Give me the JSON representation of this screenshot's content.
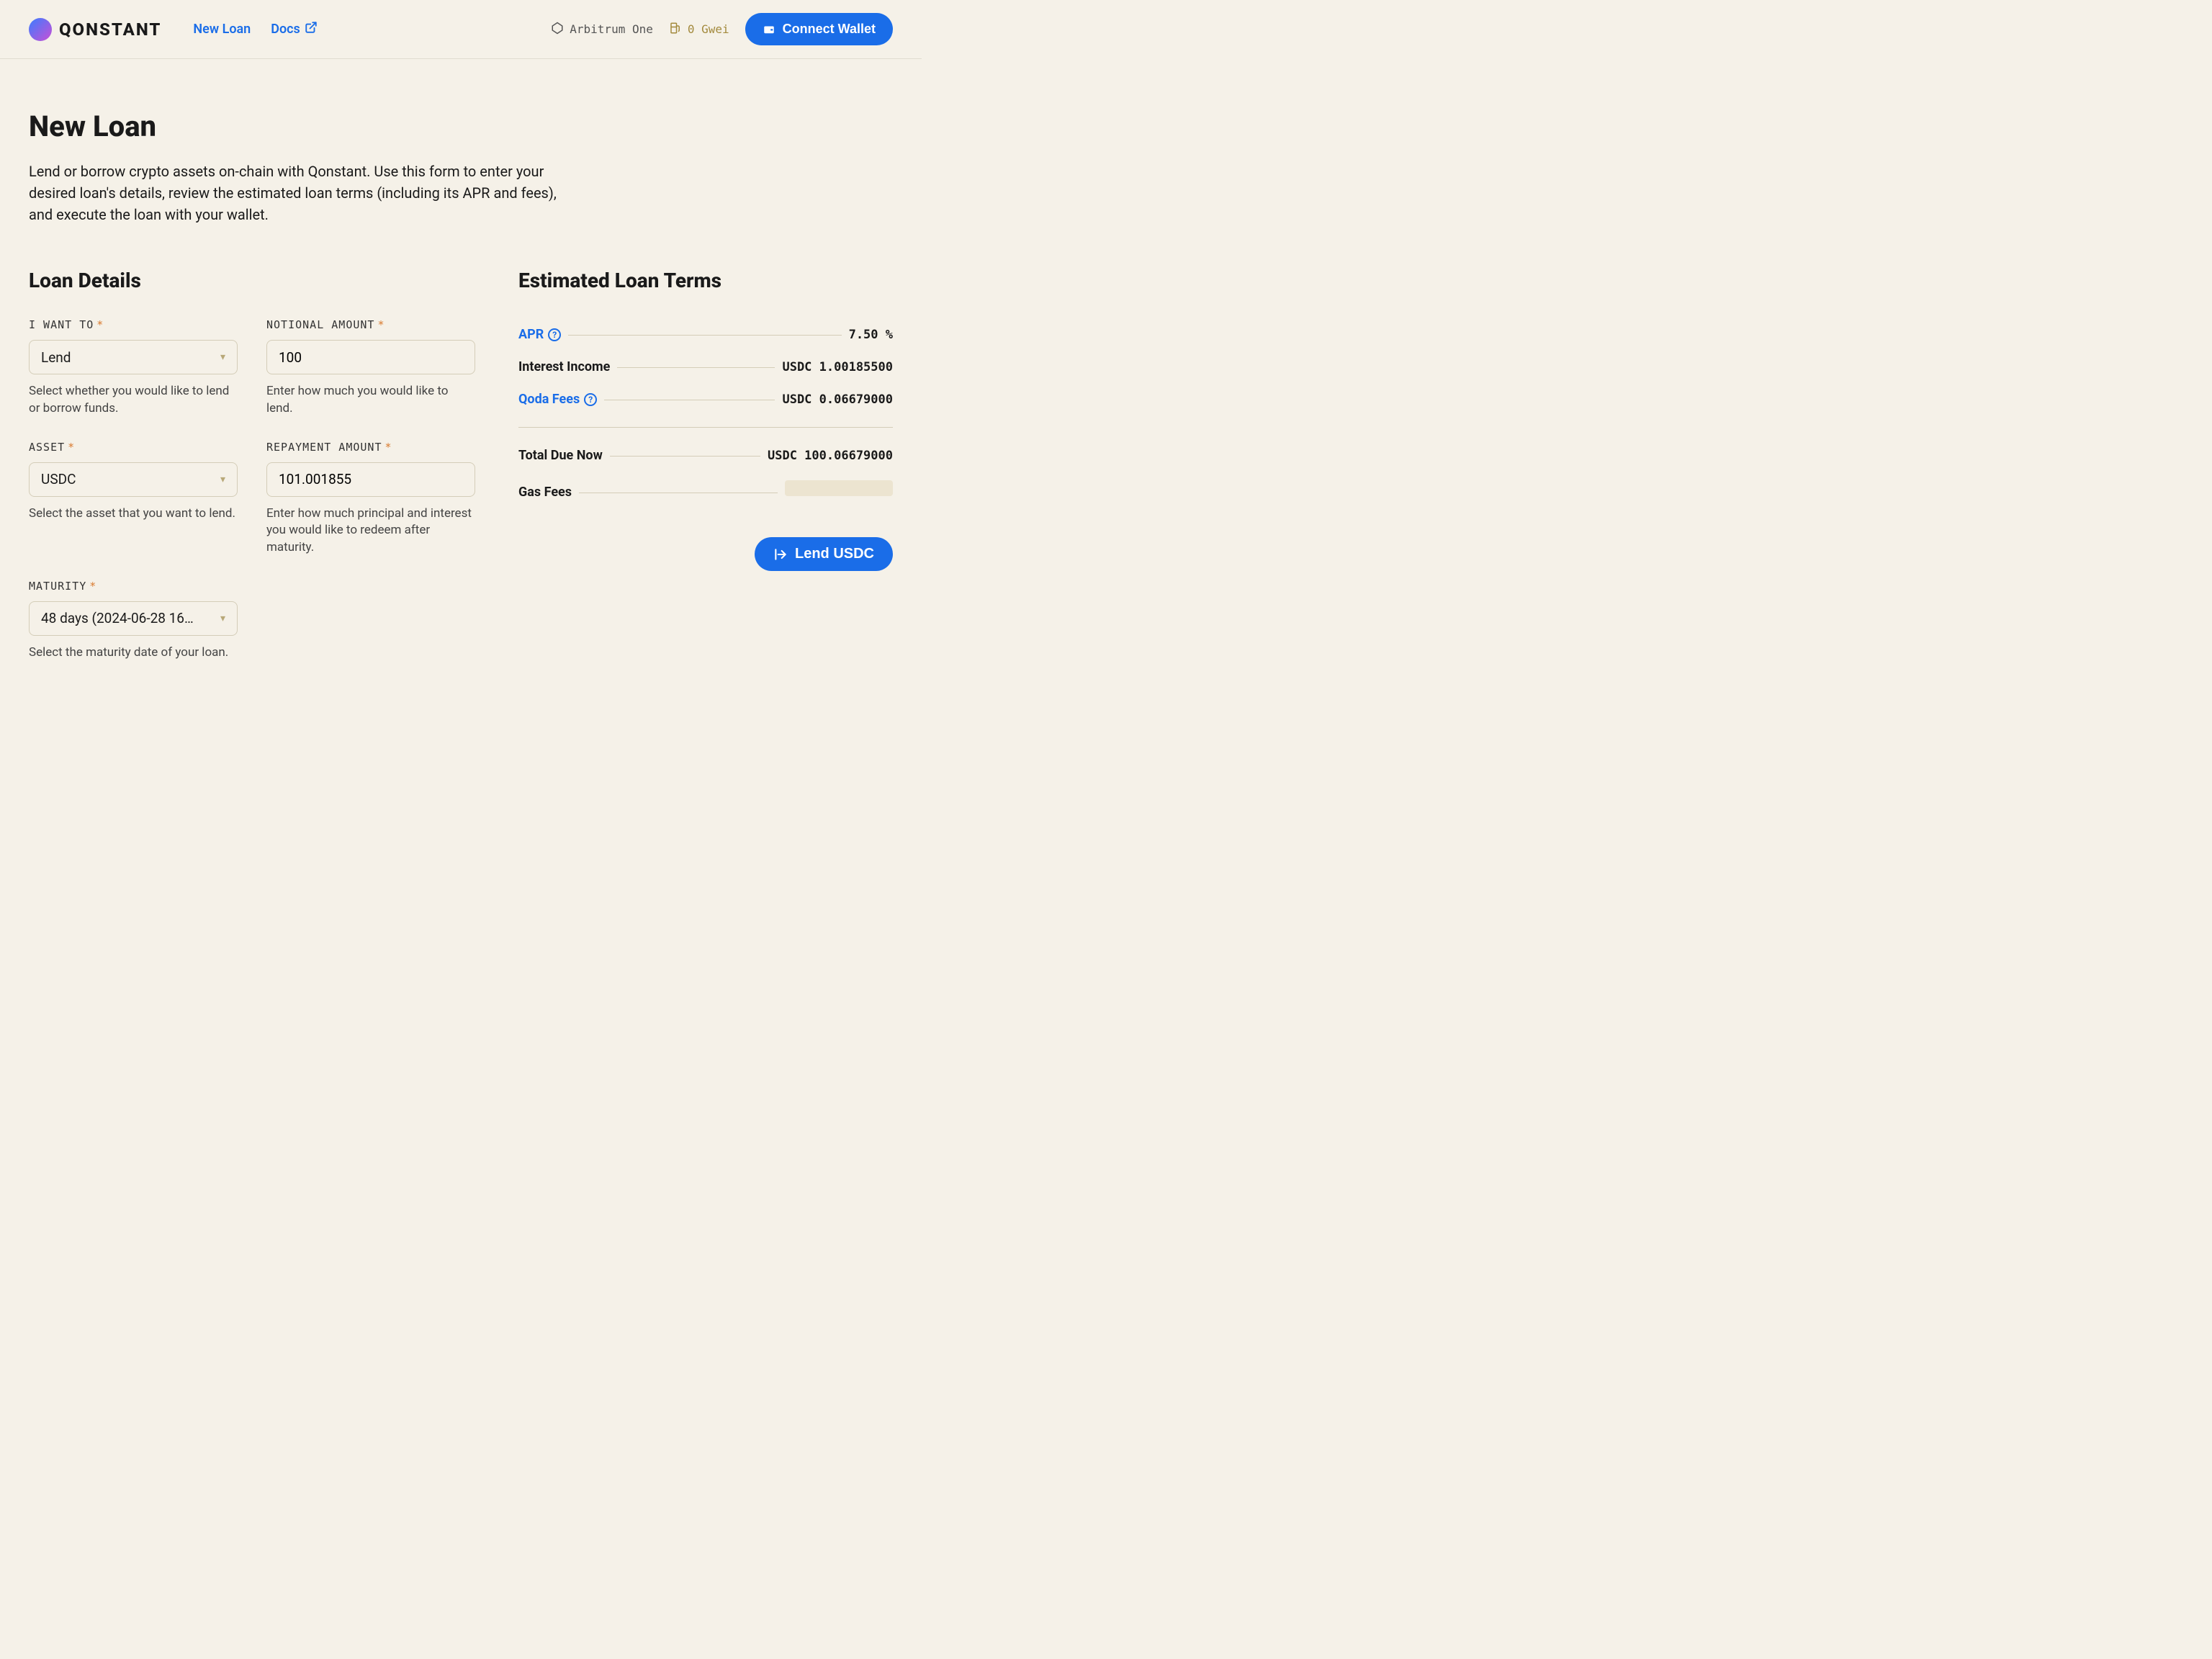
{
  "header": {
    "brand": "QONSTANT",
    "nav": {
      "new_loan": "New Loan",
      "docs": "Docs"
    },
    "chain": "Arbitrum One",
    "gas": "0 Gwei",
    "connect": "Connect Wallet"
  },
  "page": {
    "title": "New Loan",
    "description": "Lend or borrow crypto assets on-chain with Qonstant. Use this form to enter your desired loan's details, review the estimated loan terms (including its APR and fees), and execute the loan with your wallet."
  },
  "loan_details": {
    "title": "Loan Details",
    "i_want_to": {
      "label": "I WANT TO",
      "value": "Lend",
      "help": "Select whether you would like to lend or borrow funds."
    },
    "asset": {
      "label": "ASSET",
      "value": "USDC",
      "help": "Select the asset that you want to lend."
    },
    "maturity": {
      "label": "MATURITY",
      "value": "48 days (2024-06-28 16…",
      "help": "Select the maturity date of your loan."
    },
    "notional": {
      "label": "NOTIONAL AMOUNT",
      "value": "100",
      "help": "Enter how much you would like to lend."
    },
    "repayment": {
      "label": "REPAYMENT AMOUNT",
      "value": "101.001855",
      "help": "Enter how much principal and interest you would like to redeem after maturity."
    }
  },
  "terms": {
    "title": "Estimated Loan Terms",
    "apr": {
      "label": "APR",
      "value": "7.50 %"
    },
    "interest": {
      "label": "Interest Income",
      "value": "USDC 1.00185500"
    },
    "fees": {
      "label": "Qoda Fees",
      "value": "USDC 0.06679000"
    },
    "total": {
      "label": "Total Due Now",
      "value": "USDC 100.06679000"
    },
    "gas": {
      "label": "Gas Fees"
    },
    "action": "Lend USDC"
  }
}
